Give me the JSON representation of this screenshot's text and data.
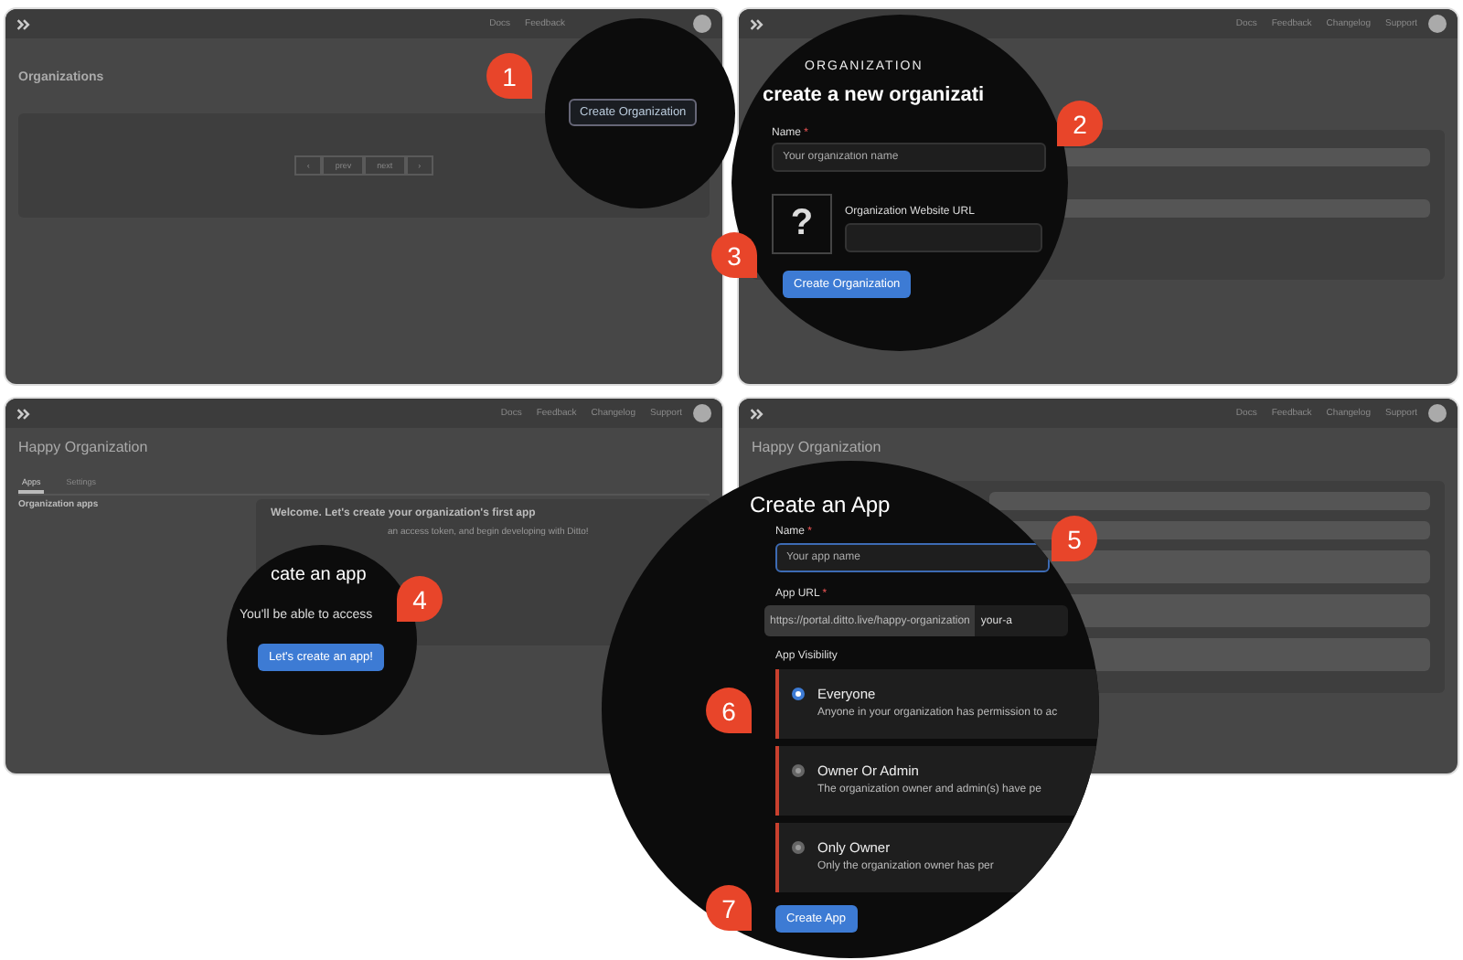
{
  "panel_1": {
    "nav": [
      "Docs",
      "Feedback"
    ],
    "title": "Organizations",
    "pagination": [
      "‹",
      "prev",
      "next",
      "›"
    ],
    "magnifier": {
      "button": "Create Organization"
    }
  },
  "panel_2": {
    "nav": [
      "Docs",
      "Feedback",
      "Changelog",
      "Support"
    ],
    "magnifier": {
      "eyebrow": "ORGANIZATION",
      "heading": "create a new organizati",
      "name_label": "Name",
      "name_required_mark": "*",
      "name_placeholder": "Your organization name",
      "logo_placeholder": "?",
      "url_label": "Organization Website URL",
      "button": "Create Organization"
    }
  },
  "panel_3": {
    "nav": [
      "Docs",
      "Feedback",
      "Changelog",
      "Support"
    ],
    "title": "Happy Organization",
    "tabs": [
      {
        "label": "Apps",
        "selected": true
      },
      {
        "label": "Settings",
        "selected": false
      }
    ],
    "sidebar_heading": "Organization apps",
    "welcome_title": "Welcome. Let's create your organization's first app",
    "welcome_text": "an access token, and begin developing with Ditto!",
    "magnifier": {
      "heading": "cate an app",
      "text": "You'll be able to access",
      "button": "Let's create an app!"
    }
  },
  "panel_4": {
    "nav": [
      "Docs",
      "Feedback",
      "Changelog",
      "Support"
    ],
    "title": "Happy Organization",
    "magnifier": {
      "heading": "Create an App",
      "name_label": "Name",
      "name_required_mark": "*",
      "name_placeholder": "Your app name",
      "url_label": "App URL",
      "url_required_mark": "*",
      "url_prefix": "https://portal.ditto.live/happy-organization",
      "url_value": "your-a",
      "visibility_label": "App Visibility",
      "options": [
        {
          "label": "Everyone",
          "description": "Anyone in your organization has permission to ac",
          "selected": true
        },
        {
          "label": "Owner Or Admin",
          "description": "The organization owner and admin(s) have pe",
          "selected": false
        },
        {
          "label": "Only Owner",
          "description": "Only the organization owner has per",
          "selected": false
        }
      ],
      "button": "Create App"
    }
  },
  "steps": [
    "1",
    "2",
    "3",
    "4",
    "5",
    "6",
    "7"
  ]
}
